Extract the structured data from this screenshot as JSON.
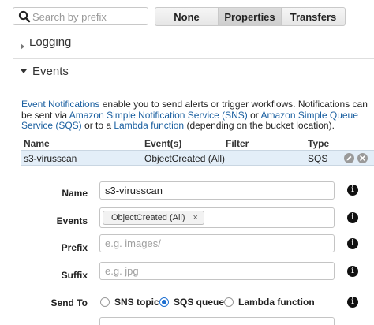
{
  "search": {
    "placeholder": "Search by prefix",
    "value": ""
  },
  "tabs": [
    {
      "label": "None",
      "active": false
    },
    {
      "label": "Properties",
      "active": true
    },
    {
      "label": "Transfers",
      "active": false
    }
  ],
  "sections": {
    "logging": {
      "label": "Logging",
      "expanded": false
    },
    "events": {
      "label": "Events",
      "expanded": true
    }
  },
  "description": {
    "link_event_notifications": "Event Notifications",
    "text_1": " enable you to send alerts or trigger workflows. Notifications can be sent via ",
    "link_sns": "Amazon Simple Notification Service (SNS)",
    "text_2": " or ",
    "link_sqs": "Amazon Simple Queue Service (SQS)",
    "text_3": " or to a ",
    "link_lambda": "Lambda function",
    "text_4": " (depending on the bucket location)."
  },
  "table": {
    "headers": {
      "name": "Name",
      "events": "Event(s)",
      "filter": "Filter",
      "type": "Type"
    },
    "rows": [
      {
        "name": "s3-virusscan",
        "events": "ObjectCreated (All)",
        "filter": "",
        "type": "SQS"
      }
    ],
    "edit_icon": "pencil-icon",
    "delete_icon": "close-icon"
  },
  "form": {
    "name": {
      "label": "Name",
      "value": "s3-virusscan"
    },
    "events": {
      "label": "Events",
      "chips": [
        "ObjectCreated (All)"
      ],
      "remove_glyph": "×"
    },
    "prefix": {
      "label": "Prefix",
      "placeholder": "e.g. images/"
    },
    "suffix": {
      "label": "Suffix",
      "placeholder": "e.g. jpg"
    },
    "send_to": {
      "label": "Send To",
      "options": [
        "SNS topic",
        "SQS queue",
        "Lambda function"
      ],
      "selected": "SQS queue"
    },
    "info_glyph": "i"
  },
  "colors": {
    "link": "#1a5fa0",
    "row_highlight": "#e3eef8",
    "radio_selected": "#1d6fd1"
  }
}
